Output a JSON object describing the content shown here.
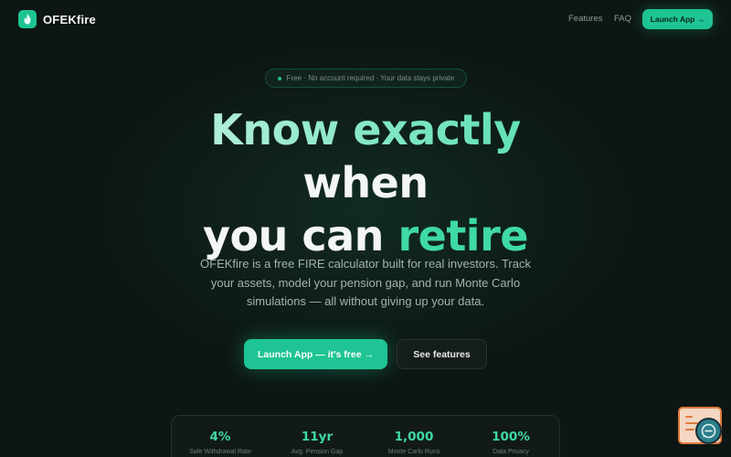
{
  "nav": {
    "brand": "OFEKfire",
    "links": [
      {
        "label": "Features"
      },
      {
        "label": "FAQ"
      }
    ],
    "cta_label": "Launch App →"
  },
  "hero": {
    "badge": "Free · No account required · Your data stays private",
    "headline": {
      "line1": "Know exactly",
      "line2": "when",
      "line3_plain": "you can ",
      "line3_accent": "retire"
    },
    "subtext": "OFEKfire is a free FIRE calculator built for real investors. Track your assets, model your pension gap, and run Monte Carlo simulations — all without giving up your data.",
    "primary_cta": "Launch App — it's free →",
    "secondary_cta": "See features"
  },
  "stats": [
    {
      "value": "4%",
      "label": "Safe Withdrawal Rate"
    },
    {
      "value": "11yr",
      "label": "Avg. Pension Gap"
    },
    {
      "value": "1,000",
      "label": "Monte Carlo Runs"
    },
    {
      "value": "100%",
      "label": "Data Privacy"
    }
  ],
  "colors": {
    "background": "#0d1613",
    "accent": "#1ec493",
    "accent_text": "#3fd9a6",
    "muted_text": "#a7b2ad",
    "widget_orange": "#e07a3c"
  },
  "icons": {
    "logo": "flame-icon",
    "widget": "chat-icon"
  }
}
